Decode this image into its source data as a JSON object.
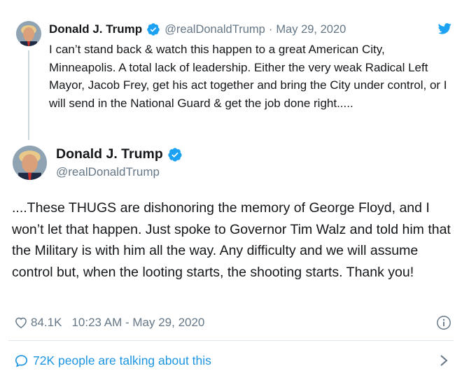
{
  "colors": {
    "text": "#14171a",
    "muted": "#657786",
    "accent": "#1b95e0",
    "twitter_blue": "#1da1f2",
    "divider": "#e1e8ed"
  },
  "parent_tweet": {
    "display_name": "Donald J. Trump",
    "handle": "@realDonaldTrump",
    "separator": "·",
    "date": "May 29, 2020",
    "text": "I can’t stand back & watch this happen to a great American City, Minneapolis. A total lack of leadership. Either the very weak Radical Left Mayor, Jacob Frey, get his act together and bring the City under control, or I will send in the National Guard & get the job done right.....",
    "verified_icon": "verified-badge-icon",
    "platform_icon": "twitter-bird-icon"
  },
  "main_tweet": {
    "display_name": "Donald J. Trump",
    "handle": "@realDonaldTrump",
    "text": "....These THUGS are dishonoring the memory of George Floyd, and I won’t let that happen. Just spoke to Governor Tim Walz and told him that the Military is with him all the way. Any difficulty and we will assume control but, when the looting starts, the shooting starts. Thank you!",
    "likes": "84.1K",
    "timestamp": "10:23 AM - May 29, 2020",
    "like_icon": "heart-icon",
    "info_icon": "info-icon"
  },
  "footer": {
    "talk_text": "72K people are talking about this",
    "talk_icon": "speech-bubble-icon",
    "chevron_icon": "chevron-right-icon"
  }
}
